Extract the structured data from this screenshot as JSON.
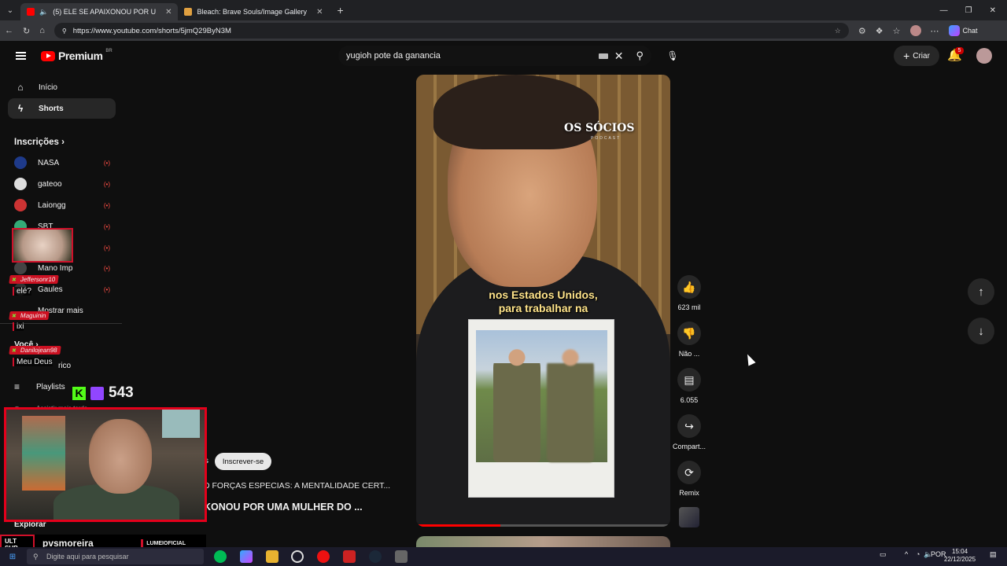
{
  "browser": {
    "tabs": [
      {
        "title": "(5) ELE SE APAIXONOU POR U",
        "active": true
      },
      {
        "title": "Bleach: Brave Souls/Image Gallery",
        "active": false
      }
    ],
    "url": "https://www.youtube.com/shorts/5jmQ29ByN3M",
    "chat_label": "Chat"
  },
  "youtube": {
    "logo_text": "Premium",
    "logo_region": "BR",
    "search_query": "yugioh pote da ganancia",
    "create_label": "Criar",
    "notification_count": "5"
  },
  "sidebar": {
    "home": "Início",
    "shorts": "Shorts",
    "subscriptions_header": "Inscrições",
    "subscriptions": [
      {
        "name": "NASA",
        "live": "(•)"
      },
      {
        "name": "gateoo",
        "live": "(•)"
      },
      {
        "name": "Laiongg",
        "live": "(•)"
      },
      {
        "name": "SBT",
        "live": "(•)"
      },
      {
        "name": "",
        "live": "(•)"
      },
      {
        "name": "Mano Imp",
        "live": "(•)"
      },
      {
        "name": "Gaules",
        "live": "(•)"
      }
    ],
    "show_more": "Mostrar mais",
    "you_header": "Você",
    "history_partial": "rico",
    "playlists": "Playlists",
    "watch_later_partial": "Assistir mais tarde",
    "explore": "Explorar"
  },
  "video": {
    "brand": "OS SÓCIOS",
    "brand_sub": "PODCAST",
    "caption_line1": "nos Estados Unidos,",
    "caption_line2": "para trabalhar na",
    "progress": 0.33,
    "subscribe_label": "Inscrever-se",
    "channel_partial": "s",
    "title_line1": "D FORÇAS ESPECIAS: A MENTALIDADE CERT...",
    "title_line2": "KONOU POR UMA MULHER DO ..."
  },
  "actions": {
    "likes": "623 mil",
    "dislike": "Não ...",
    "comments": "6.055",
    "share": "Compart...",
    "remix": "Remix"
  },
  "stream": {
    "chat": [
      {
        "user": "Jeffersonr10",
        "message": "elé?"
      },
      {
        "user": "Maguinin",
        "message": "ixi"
      },
      {
        "user": "Danilojean98",
        "message": "Meu Deus"
      }
    ],
    "viewer_count": "543",
    "streamer": "pvsmoreira",
    "badge_top": "ULT",
    "badge_bottom": "SUB",
    "sponsor": "LUMEIOFICIAL"
  },
  "taskbar": {
    "search_placeholder": "Digite aqui para pesquisar",
    "language": "POR",
    "time": "15:04",
    "date": "22/12/2025"
  }
}
